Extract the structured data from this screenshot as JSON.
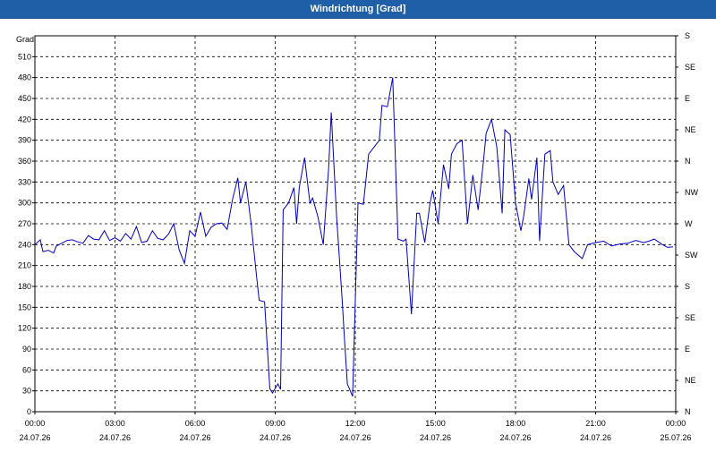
{
  "window": {
    "title": "Windrichtung [Grad]"
  },
  "chart_data": {
    "type": "line",
    "title": "Windrichtung [Grad]",
    "ylabel": "Grad",
    "xlabel": "",
    "ylim": [
      0,
      540
    ],
    "y_ticks": [
      0,
      30,
      60,
      90,
      120,
      150,
      180,
      210,
      240,
      270,
      300,
      330,
      360,
      390,
      420,
      450,
      480,
      510
    ],
    "right_axis_labels": [
      {
        "value": 0,
        "label": "N"
      },
      {
        "value": 45,
        "label": "NE"
      },
      {
        "value": 90,
        "label": "E"
      },
      {
        "value": 135,
        "label": "SE"
      },
      {
        "value": 180,
        "label": "S"
      },
      {
        "value": 225,
        "label": "SW"
      },
      {
        "value": 270,
        "label": "W"
      },
      {
        "value": 315,
        "label": "NW"
      },
      {
        "value": 360,
        "label": "N"
      },
      {
        "value": 405,
        "label": "NE"
      },
      {
        "value": 450,
        "label": "E"
      },
      {
        "value": 495,
        "label": "SE"
      },
      {
        "value": 540,
        "label": "S"
      }
    ],
    "xlim_hours": [
      0,
      24
    ],
    "x_ticks": [
      {
        "hour": 0,
        "time": "00:00",
        "date": "24.07.26"
      },
      {
        "hour": 3,
        "time": "03:00",
        "date": "24.07.26"
      },
      {
        "hour": 6,
        "time": "06:00",
        "date": "24.07.26"
      },
      {
        "hour": 9,
        "time": "09:00",
        "date": "24.07.26"
      },
      {
        "hour": 12,
        "time": "12:00",
        "date": "24.07.26"
      },
      {
        "hour": 15,
        "time": "15:00",
        "date": "24.07.26"
      },
      {
        "hour": 18,
        "time": "18:00",
        "date": "24.07.26"
      },
      {
        "hour": 21,
        "time": "21:00",
        "date": "24.07.26"
      },
      {
        "hour": 24,
        "time": "00:00",
        "date": "25.07.26"
      }
    ],
    "grid": true,
    "line_color": "#0000c0",
    "series": [
      {
        "name": "",
        "x": [
          0.0,
          0.2,
          0.3,
          0.5,
          0.7,
          0.8,
          1.0,
          1.2,
          1.4,
          1.6,
          1.8,
          2.0,
          2.2,
          2.4,
          2.6,
          2.8,
          3.0,
          3.2,
          3.4,
          3.6,
          3.8,
          4.0,
          4.2,
          4.4,
          4.6,
          4.8,
          5.0,
          5.2,
          5.4,
          5.6,
          5.8,
          6.0,
          6.2,
          6.4,
          6.6,
          6.8,
          7.0,
          7.2,
          7.4,
          7.6,
          7.7,
          7.9,
          8.1,
          8.3,
          8.4,
          8.6,
          8.8,
          8.9,
          9.1,
          9.2,
          9.3,
          9.5,
          9.7,
          9.8,
          9.9,
          10.1,
          10.3,
          10.4,
          10.6,
          10.8,
          11.0,
          11.1,
          11.3,
          11.5,
          11.6,
          11.7,
          11.9,
          12.1,
          12.3,
          12.5,
          12.7,
          12.9,
          13.0,
          13.2,
          13.4,
          13.6,
          13.8,
          13.9,
          14.1,
          14.3,
          14.4,
          14.6,
          14.8,
          14.9,
          15.1,
          15.3,
          15.5,
          15.6,
          15.8,
          16.0,
          16.2,
          16.4,
          16.6,
          16.8,
          16.9,
          17.1,
          17.3,
          17.5,
          17.6,
          17.8,
          18.0,
          18.2,
          18.3,
          18.5,
          18.6,
          18.8,
          18.9,
          19.1,
          19.3,
          19.4,
          19.6,
          19.8,
          20.0,
          20.2,
          20.5,
          20.7,
          21.0,
          21.3,
          21.6,
          21.9,
          22.2,
          22.5,
          22.8,
          23.0,
          23.2,
          23.5,
          23.7,
          23.9
        ],
        "values": [
          240,
          247,
          230,
          232,
          228,
          238,
          242,
          246,
          247,
          244,
          242,
          253,
          248,
          247,
          260,
          246,
          250,
          245,
          256,
          248,
          266,
          243,
          245,
          260,
          249,
          247,
          255,
          270,
          233,
          213,
          260,
          252,
          287,
          252,
          265,
          270,
          271,
          262,
          305,
          336,
          300,
          330,
          270,
          195,
          160,
          158,
          33,
          27,
          40,
          32,
          290,
          300,
          322,
          270,
          322,
          365,
          300,
          307,
          280,
          240,
          350,
          430,
          280,
          165,
          100,
          40,
          22,
          300,
          298,
          370,
          380,
          390,
          440,
          438,
          480,
          248,
          245,
          248,
          140,
          285,
          285,
          243,
          300,
          318,
          270,
          355,
          320,
          370,
          385,
          390,
          270,
          340,
          290,
          360,
          400,
          420,
          380,
          285,
          405,
          398,
          300,
          260,
          280,
          335,
          305,
          365,
          245,
          370,
          375,
          330,
          312,
          325,
          240,
          230,
          220,
          240,
          243,
          245,
          238,
          241,
          242,
          246,
          243,
          245,
          248,
          240,
          236,
          237
        ]
      }
    ]
  }
}
